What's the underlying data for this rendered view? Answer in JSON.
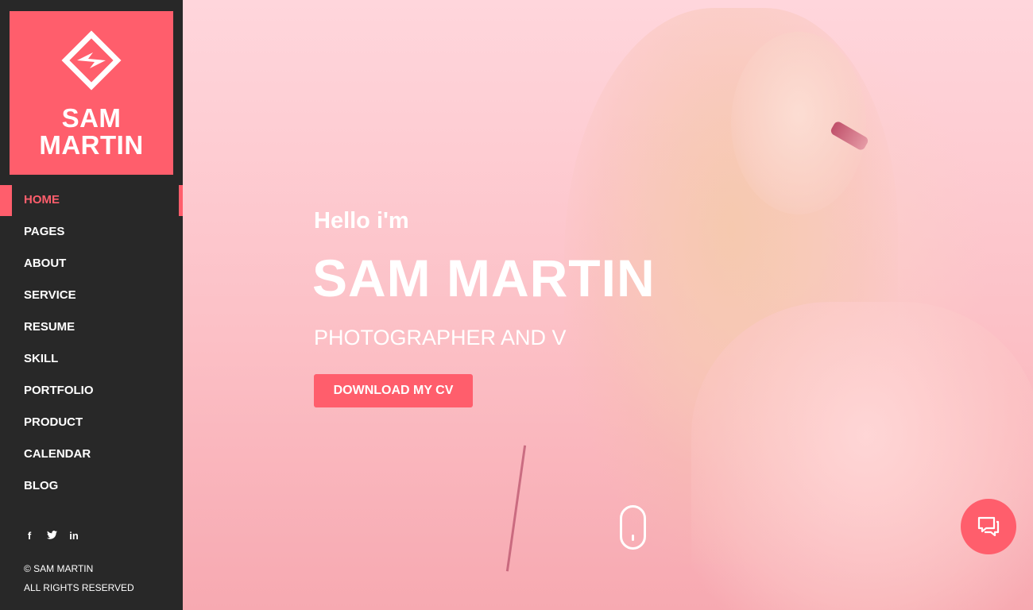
{
  "brand": {
    "name_line1": "SAM",
    "name_line2": "MARTIN",
    "logo_icon": "diamond-s-logo-icon",
    "accent": "#ff5e6c"
  },
  "nav": {
    "items": [
      {
        "label": "HOME",
        "active": true
      },
      {
        "label": "PAGES"
      },
      {
        "label": "ABOUT"
      },
      {
        "label": "SERVICE"
      },
      {
        "label": "RESUME"
      },
      {
        "label": "SKILL"
      },
      {
        "label": "PORTFOLIO"
      },
      {
        "label": "PRODUCT"
      },
      {
        "label": "CALENDAR"
      },
      {
        "label": "BLOG"
      }
    ]
  },
  "social": {
    "facebook": "f",
    "twitter": "🐦",
    "linkedin": "in"
  },
  "footer": {
    "copyright": "© SAM MARTIN",
    "rights": "ALL RIGHTS RESERVED"
  },
  "hero": {
    "greeting": "Hello i'm",
    "name": "SAM MARTIN",
    "role": "PHOTOGRAPHER AND V",
    "cta": "DOWNLOAD MY CV"
  },
  "icons": {
    "scroll": "mouse-scroll-icon",
    "chat": "chat-bubbles-icon"
  }
}
